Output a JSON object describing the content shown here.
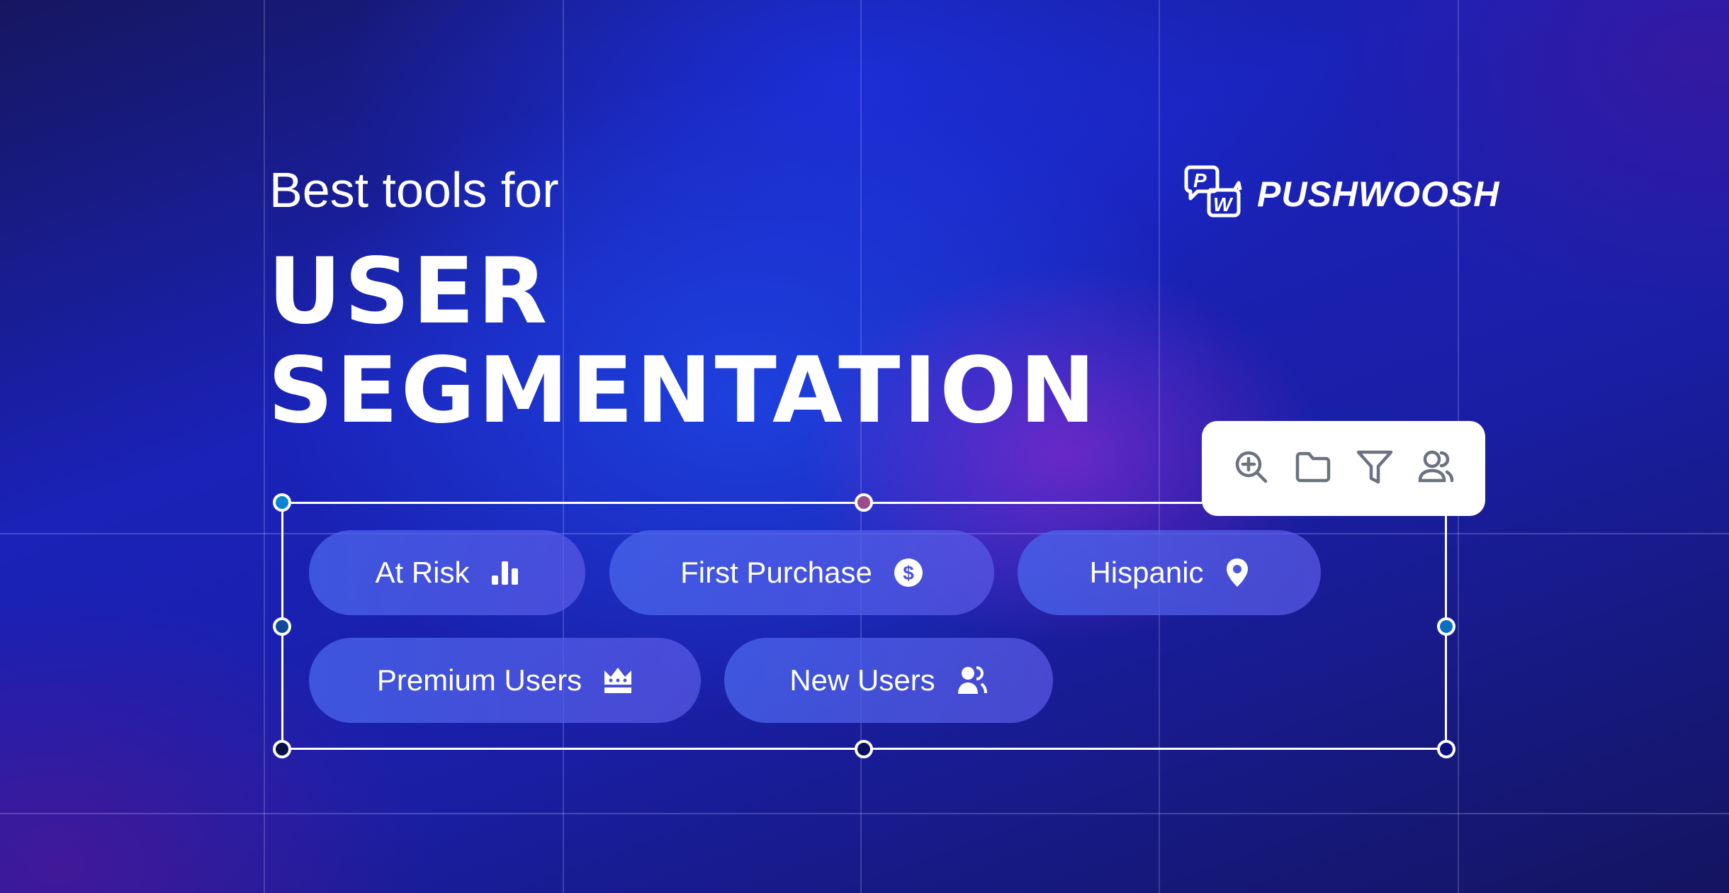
{
  "banner": {
    "subtitle": "Best tools for",
    "headline_line1": "USER",
    "headline_line2": "SEGMENTATION"
  },
  "brand": {
    "name": "PUSHWOOSH",
    "logo_icon": "pw-speech-bubbles-icon"
  },
  "toolbar": {
    "tools": [
      {
        "icon": "zoom-in-icon",
        "label": "Zoom in"
      },
      {
        "icon": "folder-icon",
        "label": "Folder"
      },
      {
        "icon": "filter-icon",
        "label": "Filter"
      },
      {
        "icon": "users-icon",
        "label": "Users"
      }
    ]
  },
  "segments": [
    {
      "label": "At Risk",
      "icon": "bar-chart-icon"
    },
    {
      "label": "First Purchase",
      "icon": "dollar-circle-icon"
    },
    {
      "label": "Hispanic",
      "icon": "location-pin-icon"
    },
    {
      "label": "Premium Users",
      "icon": "crown-icon"
    },
    {
      "label": "New Users",
      "icon": "users-icon"
    }
  ],
  "colors": {
    "background_primary": "#1a22b8",
    "chip_fill": "#4864eb",
    "toolbar_icon": "#6b7280",
    "handle_top_left": "#0a84d0",
    "handle_top_mid": "#a04a8a",
    "handle_left_mid": "#114a9a",
    "handle_right_mid": "#0b6ec0",
    "handle_bottom": "#0a1060"
  }
}
